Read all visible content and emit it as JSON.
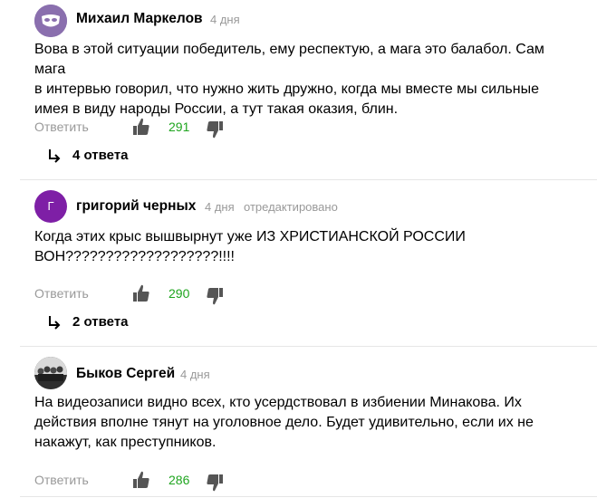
{
  "comments": [
    {
      "author": "Михаил Маркелов",
      "time": "4 дня",
      "edited": "",
      "text_lines": [
        "Вова в этой ситуации победитель, ему респектую, а мага это балабол. Сам мага",
        "в интервью говорил, что нужно жить дружно, когда мы вместе мы сильные",
        "имея в виду народы России, а тут такая оказия, блин."
      ],
      "reply_label": "Ответить",
      "likes": "291",
      "replies_label": "4 ответа",
      "avatar": {
        "type": "mask-icon",
        "color": "#8a6fae"
      }
    },
    {
      "author": "григорий черных",
      "time": "4 дня",
      "edited": "отредактировано",
      "text_lines": [
        "Когда этих крыс вышвырнут уже ИЗ ХРИСТИАНСКОЙ РОССИИ",
        "ВОН???????????????????!!!!"
      ],
      "reply_label": "Ответить",
      "likes": "290",
      "replies_label": "2 ответа",
      "avatar": {
        "type": "letter",
        "letter": "Г",
        "color": "#7e1fa6"
      }
    },
    {
      "author": "Быков Сергей",
      "time": "4 дня",
      "edited": "",
      "text_lines": [
        "На видеозаписи видно всех, кто усердствовал в избиении Минакова. Их",
        "действия вполне тянут на уголовное дело. Будет удивительно, если их не",
        "накажут, как преступников."
      ],
      "reply_label": "Ответить",
      "likes": "286",
      "replies_label": "",
      "avatar": {
        "type": "photo",
        "color": "#3a3a3a"
      }
    }
  ],
  "colors": {
    "like": "#1fa51f",
    "muted": "#999999",
    "icon": "#555555"
  }
}
